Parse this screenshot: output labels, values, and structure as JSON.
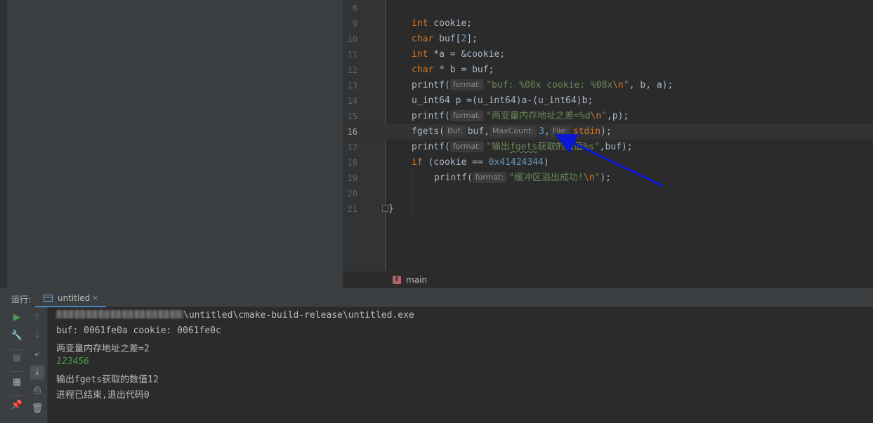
{
  "editor": {
    "lines": [
      {
        "num": "8"
      },
      {
        "num": "9",
        "t1": "int",
        "t2": " cookie;"
      },
      {
        "num": "10",
        "t1": "char",
        "t2": " buf[",
        "t3": "2",
        "t4": "];"
      },
      {
        "num": "11",
        "t1": "int",
        "t2": " *a = &cookie;"
      },
      {
        "num": "12",
        "t1": "char",
        "t2": " * b = buf;"
      },
      {
        "num": "13",
        "t1": "printf(",
        "hint": "format:",
        "s": "\"buf: %08x cookie: %08x",
        "esc": "\\n",
        "s2": "\"",
        "t2": ", b, a);"
      },
      {
        "num": "14",
        "t1": "u_int64 p =(u_int64)a-(u_int64)b;"
      },
      {
        "num": "15",
        "t1": "printf(",
        "hint": "format:",
        "s": "\"两变量内存地址之差=%d",
        "esc": "\\n",
        "s2": "\"",
        "t2": ",p);"
      },
      {
        "num": "16",
        "t1": "fgets(",
        "hint1": "Buf:",
        "t2": "buf,",
        "hint2": "MaxCount:",
        "n": "3",
        "t3": ",",
        "hint3": "File:",
        "t4": "stdin",
        "t5": ");"
      },
      {
        "num": "17",
        "t1": "printf(",
        "hint": "format:",
        "s1": "\"输出",
        "sq": "fgets",
        "s2": "获取的数值%s\"",
        "t2": ",buf);"
      },
      {
        "num": "18",
        "kw": "if",
        "t1": " (cookie == ",
        "n": "0x41424344",
        "t2": ")"
      },
      {
        "num": "19",
        "t1": "printf(",
        "hint": "format:",
        "s": "\"缓冲区溢出成功!",
        "esc": "\\n",
        "s2": "\"",
        "t2": ");"
      },
      {
        "num": "20"
      },
      {
        "num": "21",
        "t1": "}"
      }
    ]
  },
  "breadcrumb": {
    "icon_letter": "f",
    "label": "main"
  },
  "run_panel": {
    "label": "运行:",
    "tab_label": "untitled",
    "tab_close": "×",
    "exe_path": "\\untitled\\cmake-build-release\\untitled.exe",
    "output": [
      "buf: 0061fe0a cookie: 0061fe0c",
      "两变量内存地址之差=2",
      "123456",
      "输出fgets获取的数值12",
      "进程已结束,退出代码0"
    ]
  },
  "annotation": {
    "arrow_color": "#0b17d6"
  },
  "colors": {
    "keyword": "#cc7832",
    "string": "#6a8759",
    "number": "#6897bb",
    "text": "#a9b7c6",
    "tab_accent": "#4a88c7"
  }
}
